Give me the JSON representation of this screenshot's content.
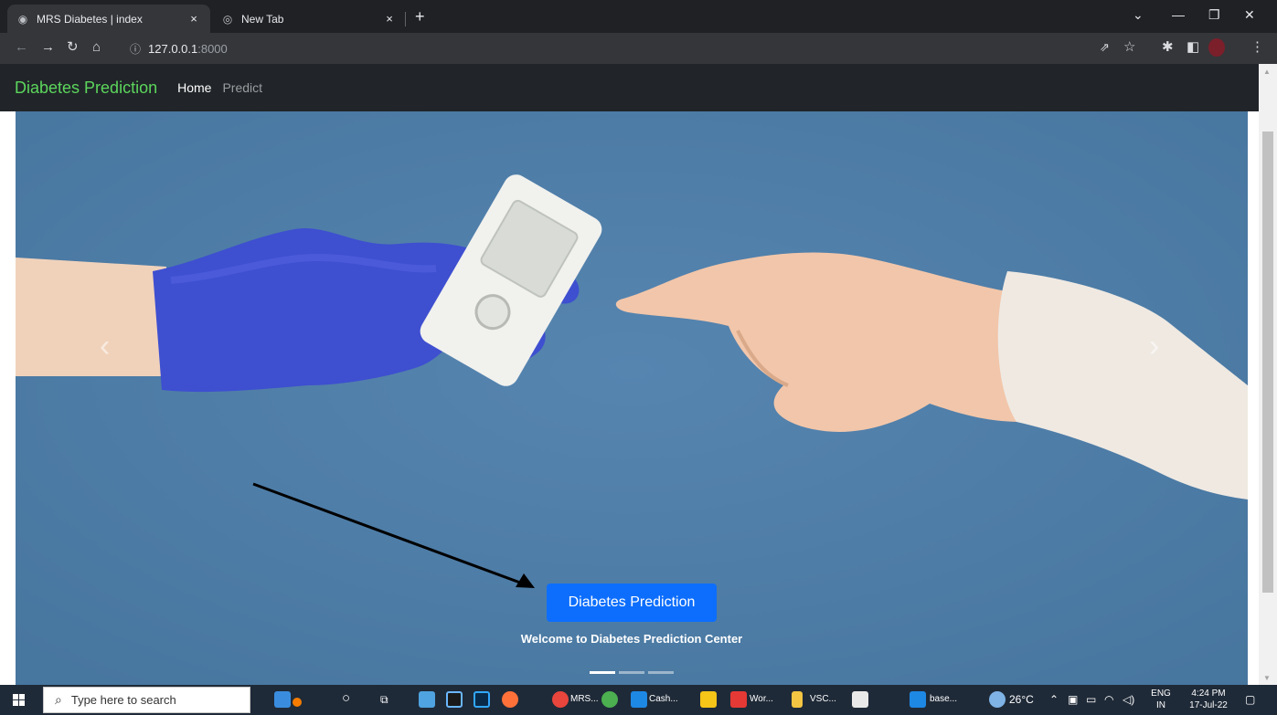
{
  "browser": {
    "tabs": [
      {
        "title": "MRS Diabetes | index",
        "icon": "globe-icon",
        "active": true
      },
      {
        "title": "New Tab",
        "icon": "chrome-icon",
        "active": false
      }
    ],
    "close_glyph": "×",
    "new_tab_glyph": "+",
    "url_host": "127.0.0.1",
    "url_port": ":8000"
  },
  "navbar": {
    "brand": "Diabetes Prediction",
    "links": [
      {
        "label": "Home",
        "active": true
      },
      {
        "label": "Predict",
        "active": false
      }
    ]
  },
  "carousel": {
    "button_label": "Diabetes Prediction",
    "caption": "Welcome to Diabetes Prediction Center",
    "indicators": [
      {
        "active": true
      },
      {
        "active": false
      },
      {
        "active": false
      }
    ]
  },
  "taskbar": {
    "search_placeholder": "Type here to search",
    "apps": [
      {
        "label": "MRS...",
        "icon": "chrome-icon",
        "color": "#e8453c"
      },
      {
        "label": "Cash...",
        "icon": "box-icon",
        "color": "#1e88e5"
      },
      {
        "label": "Wor...",
        "icon": "word-icon",
        "color": "#e53935"
      },
      {
        "label": "VSC...",
        "icon": "folder-icon",
        "color": "#f4c542"
      },
      {
        "label": "base...",
        "icon": "vscode-icon",
        "color": "#1e88e5"
      }
    ],
    "weather": "26°C",
    "language": "ENG",
    "region": "IN",
    "time": "4:24 PM",
    "date": "17-Jul-22"
  },
  "colors": {
    "brand": "#5cd65c",
    "button": "#0d6efd",
    "hero_bg": "#4e7ea8"
  }
}
